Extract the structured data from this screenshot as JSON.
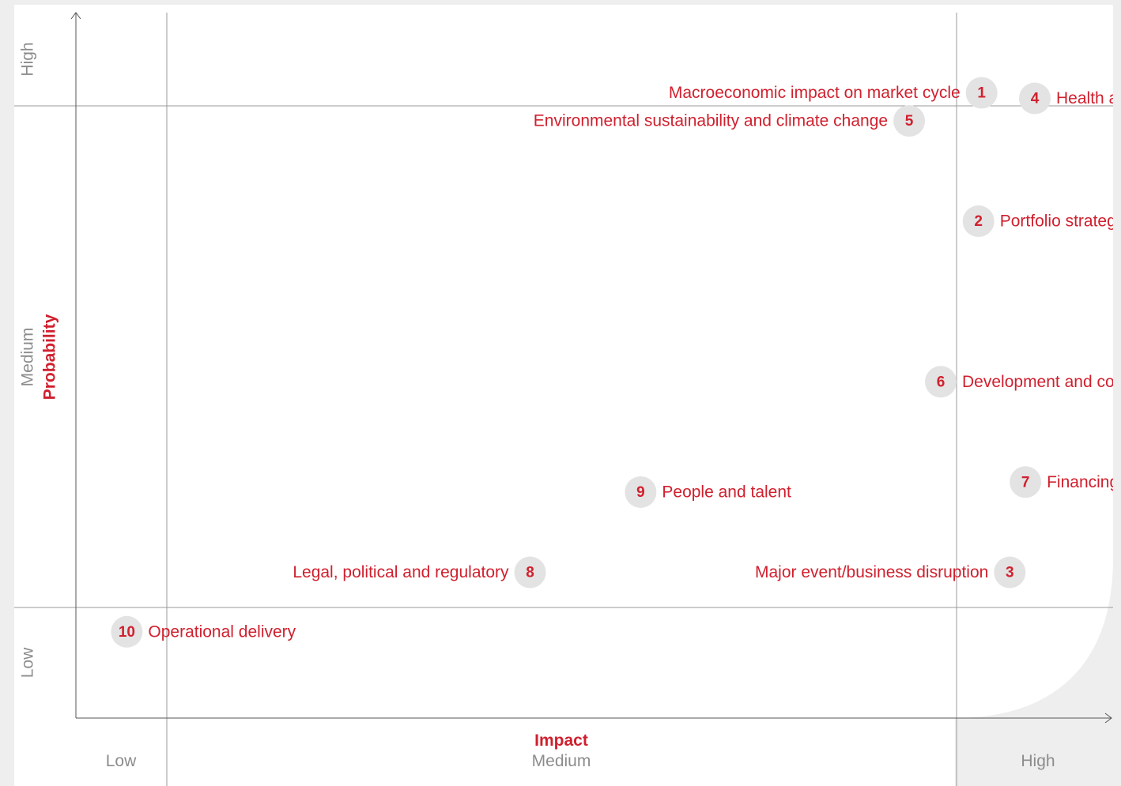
{
  "colors": {
    "accent": "#d0202e",
    "badge": "#e3e3e3",
    "muted": "#8c8c8c",
    "grid": "#9a9a9a",
    "background": "#ffffff"
  },
  "chart_data": {
    "type": "scatter",
    "xlabel": "Impact",
    "ylabel": "Probability",
    "x_bands": [
      "Low",
      "Medium",
      "High"
    ],
    "y_bands": [
      "Low",
      "Medium",
      "High"
    ],
    "xlim": [
      0,
      3
    ],
    "ylim": [
      0,
      3
    ],
    "grid": true,
    "points": [
      {
        "number": "1",
        "label": "Macroeconomic impact on market cycle",
        "x": 2.16,
        "y": 2.14,
        "label_side": "left"
      },
      {
        "number": "2",
        "label": "Portfolio strategy and execution",
        "x": 2.14,
        "y": 1.77,
        "label_side": "right"
      },
      {
        "number": "3",
        "label": "Major event/business disruption",
        "x": 2.34,
        "y": 1.07,
        "label_side": "left"
      },
      {
        "number": "4",
        "label": "Health and safety",
        "x": 2.5,
        "y": 2.08,
        "label_side": "right"
      },
      {
        "number": "5",
        "label": "Environmental sustainability and climate change",
        "x": 1.94,
        "y": 1.97,
        "label_side": "left"
      },
      {
        "number": "6",
        "label": "Development and construction execution",
        "x": 1.98,
        "y": 1.45,
        "label_side": "right"
      },
      {
        "number": "7",
        "label": "Financing strategy",
        "x": 2.44,
        "y": 1.25,
        "label_side": "right"
      },
      {
        "number": "8",
        "label": "Legal, political and regulatory",
        "x": 1.46,
        "y": 1.07,
        "label_side": "left"
      },
      {
        "number": "9",
        "label": "People and talent",
        "x": 1.6,
        "y": 1.23,
        "label_side": "right"
      },
      {
        "number": "10",
        "label": "Operational delivery",
        "x": 0.56,
        "y": 0.78,
        "label_side": "right"
      }
    ]
  }
}
